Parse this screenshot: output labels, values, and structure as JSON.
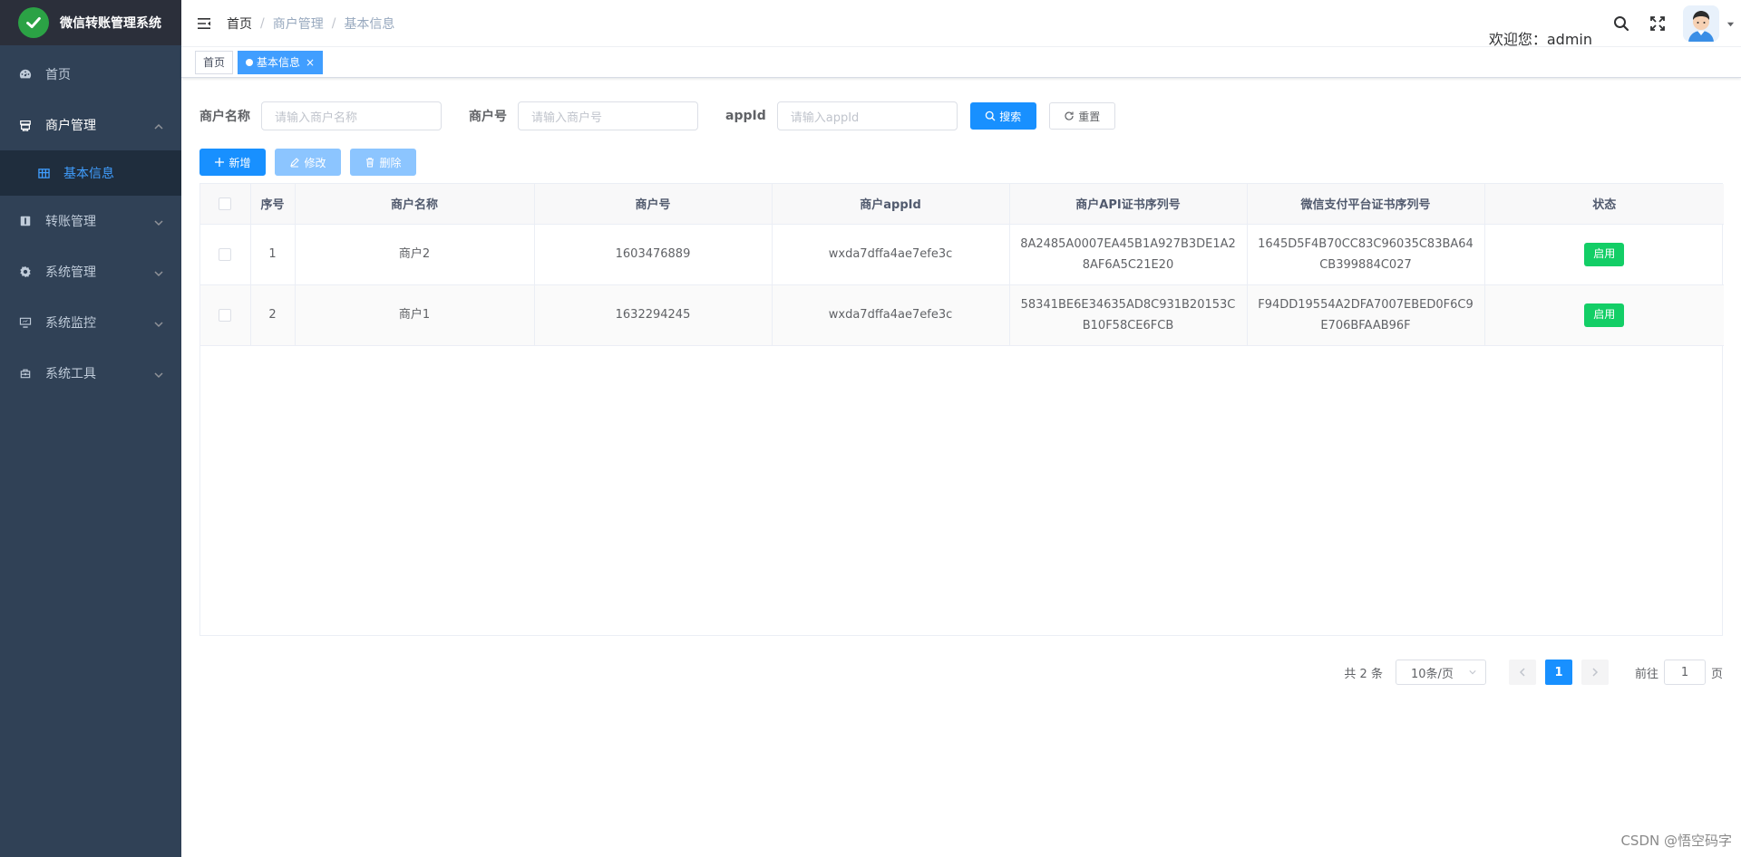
{
  "app": {
    "title": "微信转账管理系统",
    "brand_color": "#2ba245"
  },
  "sidebar": {
    "items": [
      {
        "label": "首页",
        "icon": "dashboard-icon"
      },
      {
        "label": "商户管理",
        "icon": "merchant-icon",
        "expanded": true,
        "children": [
          {
            "label": "基本信息",
            "icon": "table-icon",
            "active": true
          }
        ]
      },
      {
        "label": "转账管理",
        "icon": "transfer-icon"
      },
      {
        "label": "系统管理",
        "icon": "gear-icon"
      },
      {
        "label": "系统监控",
        "icon": "monitor-icon"
      },
      {
        "label": "系统工具",
        "icon": "toolbox-icon"
      }
    ]
  },
  "navbar": {
    "breadcrumb": [
      "首页",
      "商户管理",
      "基本信息"
    ],
    "welcome": "欢迎您：admin"
  },
  "tags": [
    {
      "label": "首页",
      "active": false
    },
    {
      "label": "基本信息",
      "active": true
    }
  ],
  "search": {
    "fields": [
      {
        "label": "商户名称",
        "placeholder": "请输入商户名称"
      },
      {
        "label": "商户号",
        "placeholder": "请输入商户号"
      },
      {
        "label": "appId",
        "placeholder": "请输入appId"
      }
    ],
    "search_label": "搜索",
    "reset_label": "重置"
  },
  "toolbar": {
    "add_label": "新增",
    "edit_label": "修改",
    "delete_label": "删除"
  },
  "table": {
    "columns": [
      "序号",
      "商户名称",
      "商户号",
      "商户appId",
      "商户API证书序列号",
      "微信支付平台证书序列号",
      "状态"
    ],
    "rows": [
      {
        "index": "1",
        "name": "商户2",
        "mch_id": "1603476889",
        "appid": "wxda7dffa4ae7efe3c",
        "api_serial": "8A2485A0007EA45B1A927B3DE1A28AF6A5C21E20",
        "platform_serial": "1645D5F4B70CC83C96035C83BA64CB399884C027",
        "status": "启用"
      },
      {
        "index": "2",
        "name": "商户1",
        "mch_id": "1632294245",
        "appid": "wxda7dffa4ae7efe3c",
        "api_serial": "58341BE6E34635AD8C931B20153CB10F58CE6FCB",
        "platform_serial": "F94DD19554A2DFA7007EBED0F6C9E706BFAAB96F",
        "status": "启用"
      }
    ],
    "status_color": "#13ce66"
  },
  "pagination": {
    "total_text": "共 2 条",
    "page_size": "10条/页",
    "current_page": "1",
    "goto_prefix": "前往",
    "goto_value": "1",
    "goto_suffix": "页"
  },
  "watermark": "CSDN @悟空码字",
  "accent_color": "#1890ff"
}
